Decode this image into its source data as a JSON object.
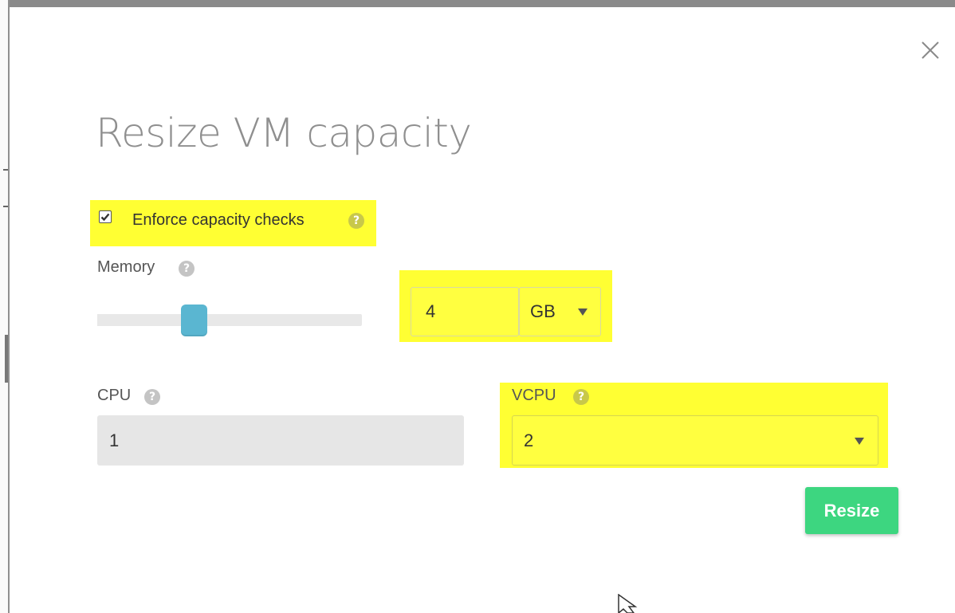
{
  "modal": {
    "title": "Resize VM capacity",
    "close_icon": "close-icon"
  },
  "enforce_checks": {
    "label": "Enforce capacity checks",
    "checked": true,
    "help_icon": "question-circle-icon"
  },
  "memory": {
    "label": "Memory",
    "help_icon": "question-circle-icon",
    "slider_fraction": 0.35,
    "value": "4",
    "unit": "GB"
  },
  "cpu": {
    "label": "CPU",
    "help_icon": "question-circle-icon",
    "value": "1"
  },
  "vcpu": {
    "label": "VCPU",
    "help_icon": "question-circle-icon",
    "value": "2"
  },
  "actions": {
    "resize_label": "Resize"
  },
  "colors": {
    "highlight": "#ffff33",
    "slider_thumb": "#5ab6d1",
    "resize_button": "#3dd680",
    "title_text": "#8f8f8f"
  }
}
